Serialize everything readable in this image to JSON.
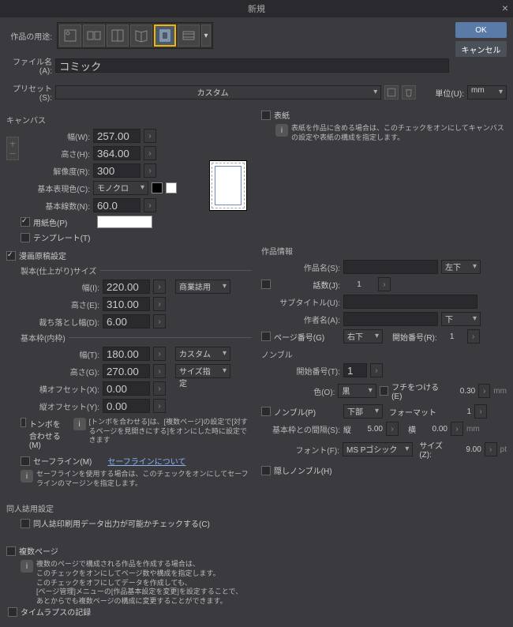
{
  "title": "新規",
  "buttons": {
    "ok": "OK",
    "cancel": "キャンセル"
  },
  "labels": {
    "usage": "作品の用途:",
    "filename": "ファイル名(A):",
    "preset": "プリセット(S):",
    "unit": "単位(U):"
  },
  "filename_value": "コミック",
  "preset_value": "カスタム",
  "unit_value": "mm",
  "canvas": {
    "title": "キャンバス",
    "width_l": "幅(W):",
    "width_v": "257.00",
    "height_l": "高さ(H):",
    "height_v": "364.00",
    "res_l": "解像度(R):",
    "res_v": "300",
    "color_l": "基本表現色(C):",
    "color_v": "モノクロ",
    "lines_l": "基本線数(N):",
    "lines_v": "60.0",
    "paper_l": "用紙色(P)",
    "template_l": "テンプレート(T)"
  },
  "manga": {
    "title": "漫画原稿設定",
    "bind_title": "製本(仕上がり)サイズ",
    "w_l": "幅(I):",
    "w_v": "220.00",
    "h_l": "高さ(E):",
    "h_v": "310.00",
    "bleed_l": "裁ち落とし幅(D):",
    "bleed_v": "6.00",
    "bind_preset": "商業誌用",
    "frame_title": "基本枠(内枠)",
    "fw_l": "幅(T):",
    "fw_v": "180.00",
    "fh_l": "高さ(G):",
    "fh_v": "270.00",
    "fox_l": "横オフセット(X):",
    "fox_v": "0.00",
    "foy_l": "縦オフセット(Y):",
    "foy_v": "0.00",
    "frame_preset": "カスタム",
    "size_spec": "サイズ指定",
    "tombo_l": "トンボを合わせる(M)",
    "tombo_help": "[トンボを合わせる]は、[複数ページ]の設定で[対するページを見開きにする]をオンにした時に設定できます",
    "safe_l": "セーフライン(M)",
    "safe_link": "セーフラインについて",
    "safe_help": "セーフラインを使用する場合は、このチェックをオンにしてセーフラインのマージンを指定します。"
  },
  "cover": {
    "title": "表紙",
    "help": "表紙を作品に含める場合は、このチェックをオンにしてキャンバスの設定や表紙の構成を指定します。"
  },
  "work": {
    "title": "作品情報",
    "name_l": "作品名(S):",
    "pos": "左下",
    "ep_l": "話数(J):",
    "ep_v": "1",
    "sub_l": "サブタイトル(U):",
    "author_l": "作者名(A):",
    "author_pos": "下",
    "pagenum_l": "ページ番号(G)",
    "pagenum_pos": "右下",
    "start_l": "開始番号(R):",
    "start_v": "1"
  },
  "nombre": {
    "title": "ノンブル",
    "start_l": "開始番号(T):",
    "start_v": "1",
    "color_l": "色(O):",
    "color_v": "黒",
    "edge_l": "フチをつける(E)",
    "edge_v": "0.30",
    "nombre_l": "ノンブル(P)",
    "pos": "下部",
    "format_l": "フォーマット",
    "format_v": "1",
    "gap_l": "基本枠との間隔(S):",
    "gap_p": "縦",
    "gap_v1": "5.00",
    "gap_p2": "横",
    "gap_v2": "0.00",
    "font_l": "フォント(F):",
    "font_v": "MS Pゴシック",
    "size_l": "サイズ(Z):",
    "size_v": "9.00",
    "hidden_l": "隠しノンブル(H)",
    "mm": "mm",
    "pt": "pt"
  },
  "doujin": {
    "title": "同人誌用設定",
    "check_l": "同人誌印刷用データ出力が可能かチェックする(C)"
  },
  "multi": {
    "title": "複数ページ",
    "help": "複数のページで構成される作品を作成する場合は、\nこのチェックをオンにしてページ数や構成を指定します。\nこのチェックをオフにしてデータを作成しても、\n[ページ管理]メニューの[作品基本設定を変更]を設定することで、\nあとからでも複数ページの構成に変更することができます。"
  },
  "timelapse": "タイムラプスの記録"
}
